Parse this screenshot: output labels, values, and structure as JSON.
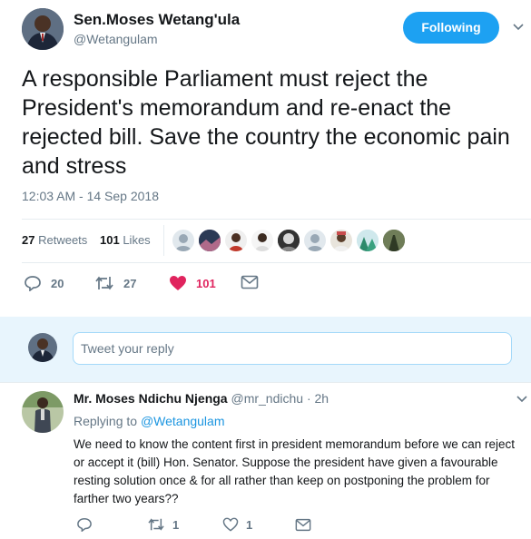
{
  "tweet": {
    "author_name": "Sen.Moses Wetang'ula",
    "author_handle": "@Wetangulam",
    "follow_label": "Following",
    "text": "A responsible Parliament must reject the President's memorandum and re-enact the rejected bill. Save the country the economic pain and stress",
    "timestamp": "12:03 AM - 14 Sep 2018",
    "retweets_count": "27",
    "retweets_label": "Retweets",
    "likes_count": "101",
    "likes_label": "Likes",
    "actions": {
      "replies": "20",
      "retweets": "27",
      "likes": "101"
    }
  },
  "reply_box": {
    "placeholder": "Tweet your reply"
  },
  "reply": {
    "author_name": "Mr. Moses Ndichu Njenga",
    "author_handle": "@mr_ndichu",
    "time": "· 2h",
    "replying_prefix": "Replying to",
    "replying_to": "@Wetangulam",
    "text": "We need to know the content first in president memorandum before we can reject or accept it (bill) Hon. Senator. Suppose the president have given a favourable resting solution once & for all rather than keep on postponing the problem for farther two years??",
    "actions": {
      "retweets": "1",
      "likes": "1"
    }
  },
  "colors": {
    "accent": "#1da1f2",
    "like": "#e0245e",
    "muted": "#657786",
    "divider": "#e6ecf0"
  }
}
